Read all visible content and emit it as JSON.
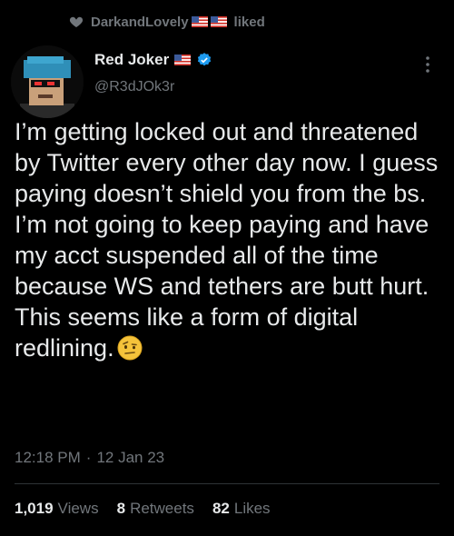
{
  "social_context": {
    "user_name": "DarkandLovely",
    "action": "liked"
  },
  "author": {
    "display_name": "Red Joker",
    "handle": "@R3dJOk3r",
    "verified": true
  },
  "tweet": {
    "text": "I’m getting locked out and threatened by Twitter every other day now. I guess paying doesn’t shield you from the bs. I’m not going to keep paying and have my acct suspended all of the time because WS and tethers are butt hurt. This seems like a form of digital redlining.",
    "time": "12:18 PM",
    "separator": "·",
    "date": "12 Jan 23"
  },
  "stats": {
    "views_count": "1,019",
    "views_label": "Views",
    "retweets_count": "8",
    "retweets_label": "Retweets",
    "likes_count": "82",
    "likes_label": "Likes"
  },
  "icons": {
    "heart": "heart-icon",
    "flag": "us-flag-icon",
    "verified": "verified-badge-icon",
    "more": "more-options-icon",
    "emoji": "face-with-raised-eyebrow-emoji"
  },
  "colors": {
    "background": "#000000",
    "text_primary": "#e7e9ea",
    "text_secondary": "#71767b",
    "verified_blue": "#1d9bf0",
    "divider": "#2f3336"
  }
}
